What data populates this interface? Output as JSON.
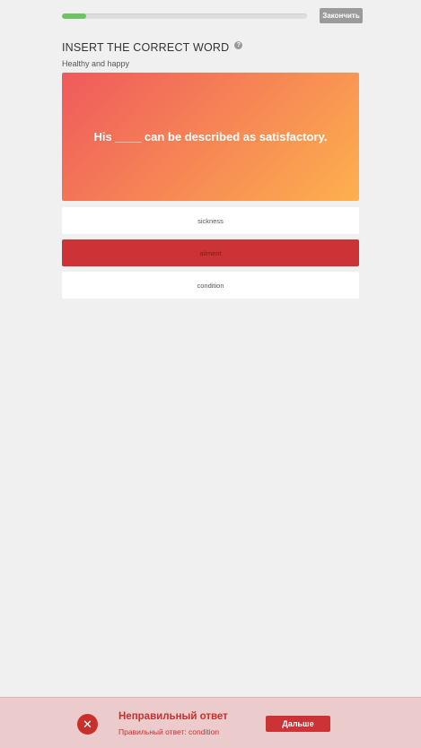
{
  "progress": {
    "value": 0.1
  },
  "header": {
    "finish_label": "Закончить"
  },
  "exercise": {
    "title": "INSERT THE CORRECT WORD",
    "help_icon": "question-circle-icon",
    "subtitle": "Healthy and happy",
    "question": "His ____ can be described as satisfactory."
  },
  "options": [
    {
      "label": "sickness",
      "state": "default"
    },
    {
      "label": "ailment",
      "state": "wrong"
    },
    {
      "label": "condition",
      "state": "default"
    }
  ],
  "feedback": {
    "icon": "close-circle-icon",
    "title": "Неправильный ответ",
    "correct_answer": "Правильный ответ: condition",
    "next_label": "Дальше"
  },
  "colors": {
    "progress_fill": "#6cc462",
    "card_gradient_start": "#ef5a5c",
    "card_gradient_end": "#fdb14e",
    "wrong_option": "#cc3336",
    "feedback_bg": "#ebcbcc",
    "feedback_text": "#c9302c",
    "next_button": "#cc3336"
  }
}
